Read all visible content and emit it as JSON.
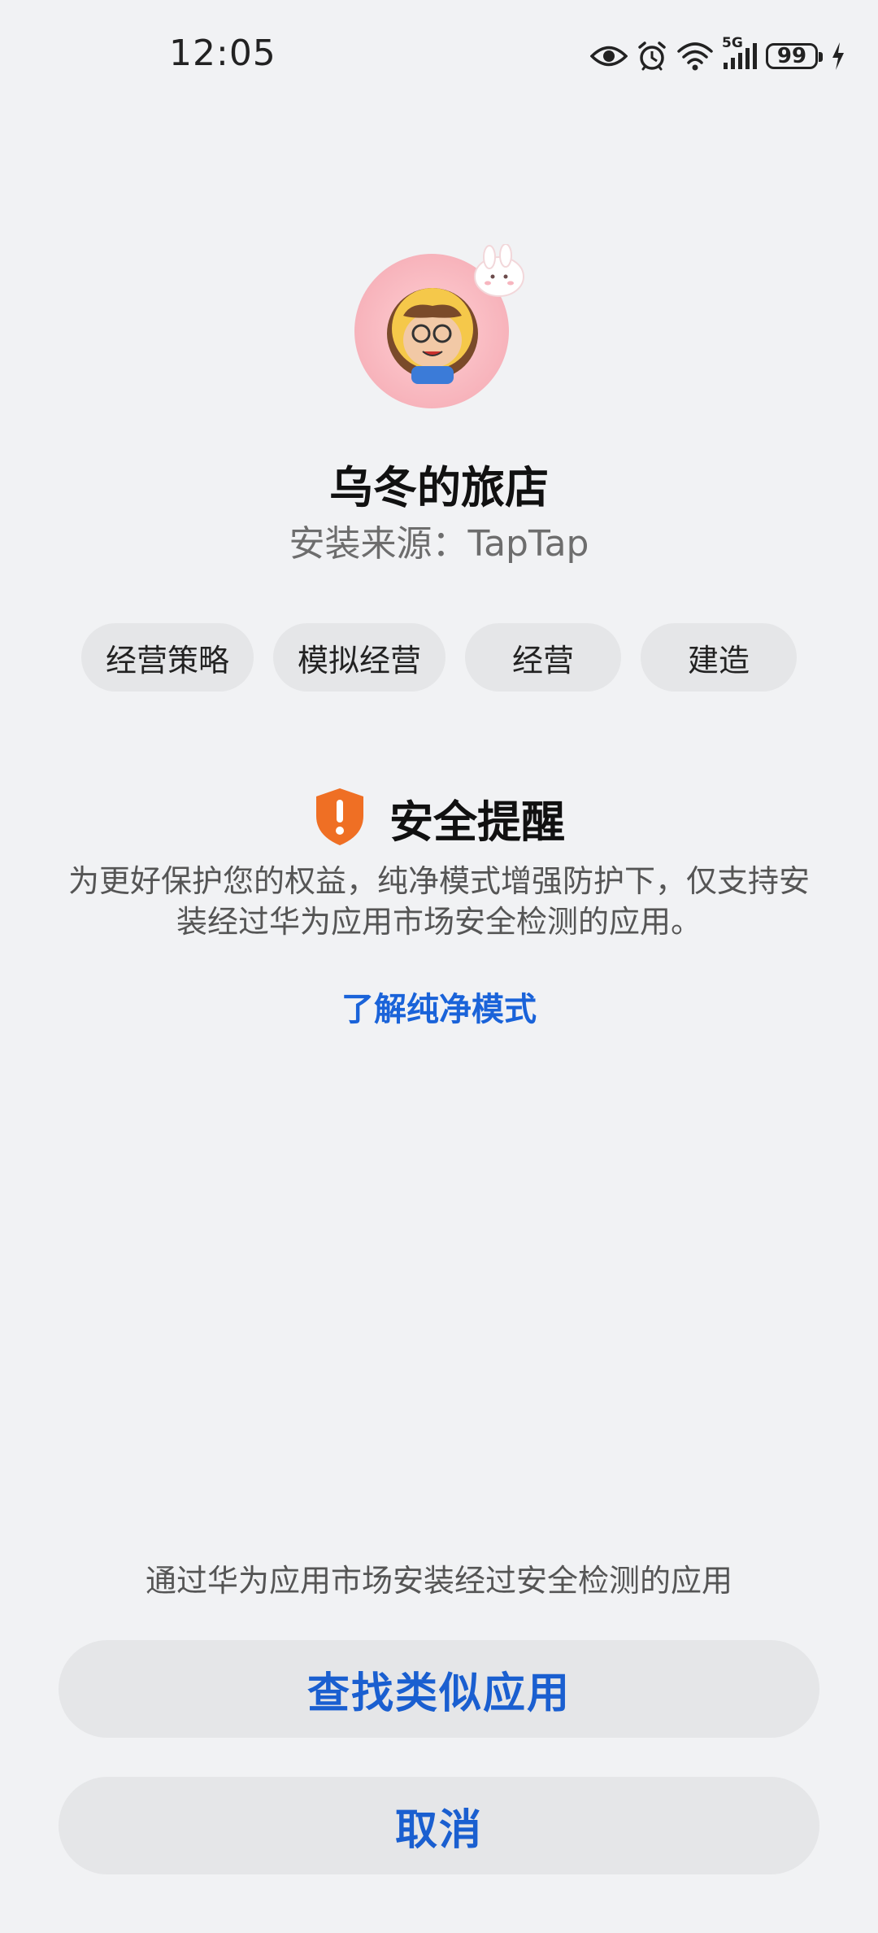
{
  "status_bar": {
    "time": "12:05",
    "network": "5G",
    "battery": "99",
    "icons": [
      "eye-icon",
      "alarm-icon",
      "wifi-icon",
      "signal-icon",
      "battery-icon",
      "charging-icon"
    ]
  },
  "app": {
    "name": "乌冬的旅店",
    "source": "安装来源：TapTap",
    "icon": "app-avatar-icon",
    "tags": [
      "经营策略",
      "模拟经营",
      "经营",
      "建造"
    ]
  },
  "security": {
    "icon": "shield-warning-icon",
    "title": "安全提醒",
    "description": "为更好保护您的权益，纯净模式增强防护下，仅支持安装经过华为应用市场安全检测的应用。",
    "link": "了解纯净模式"
  },
  "bottom": {
    "hint": "通过华为应用市场安装经过安全检测的应用",
    "find_button": "查找类似应用",
    "cancel_button": "取消"
  },
  "colors": {
    "background": "#f1f2f4",
    "accent_blue": "#1a63d9",
    "warning_orange": "#ef6f24",
    "chip_bg": "#e5e6e8"
  }
}
